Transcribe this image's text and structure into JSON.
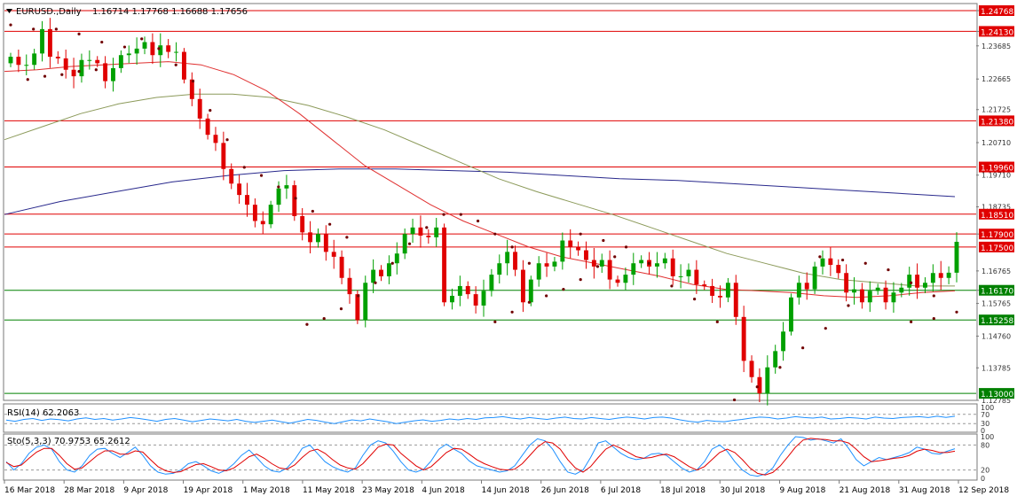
{
  "window": {
    "symbol_title": "EURUSD.,Daily",
    "ohlc": "1.16714 1.17768 1.16688 1.17656"
  },
  "colors": {
    "bull": "#00a000",
    "bear": "#e00000",
    "ma_fast": "#e03030",
    "ma_mid": "#8c9a5a",
    "ma_slow": "#28288c",
    "sar": "#700000",
    "resistance": "#e00000",
    "support": "#008000",
    "rsi": "#1e90ff",
    "stoch_main": "#1e90ff",
    "stoch_signal": "#e00000"
  },
  "chart_data": [
    {
      "type": "candlestick",
      "name": "price",
      "x_ticks": [
        "16 Mar 2018",
        "28 Mar 2018",
        "9 Apr 2018",
        "19 Apr 2018",
        "1 May 2018",
        "11 May 2018",
        "23 May 2018",
        "4 Jun 2018",
        "14 Jun 2018",
        "26 Jun 2018",
        "6 Jul 2018",
        "18 Jul 2018",
        "30 Jul 2018",
        "9 Aug 2018",
        "21 Aug 2018",
        "31 Aug 2018",
        "12 Sep 2018"
      ],
      "y_ticks": [
        "1.24768",
        "1.24130",
        "1.23685",
        "1.22665",
        "1.21725",
        "1.20710",
        "1.19710",
        "1.18735",
        "1.17900",
        "1.16765",
        "1.16170",
        "1.15765",
        "1.14760",
        "1.13785",
        "1.12785"
      ],
      "ylim": [
        1.12785,
        1.24768
      ],
      "levels": [
        {
          "value": 1.24768,
          "label": "1.24768",
          "kind": "resistance"
        },
        {
          "value": 1.2413,
          "label": "1.24130",
          "kind": "resistance"
        },
        {
          "value": 1.2138,
          "label": "1.21380",
          "kind": "resistance"
        },
        {
          "value": 1.1996,
          "label": "1.19960",
          "kind": "resistance"
        },
        {
          "value": 1.1851,
          "label": "1.18510",
          "kind": "resistance"
        },
        {
          "value": 1.179,
          "label": "1.17900",
          "kind": "resistance"
        },
        {
          "value": 1.175,
          "label": "1.17500",
          "kind": "resistance"
        },
        {
          "value": 1.1617,
          "label": "1.16170",
          "kind": "support"
        },
        {
          "value": 1.15258,
          "label": "1.15258",
          "kind": "support"
        },
        {
          "value": 1.13,
          "label": "1.13000",
          "kind": "support"
        }
      ],
      "closes": [
        1.2335,
        1.231,
        1.231,
        1.2345,
        1.242,
        1.2335,
        1.233,
        1.2295,
        1.2275,
        1.2325,
        1.2325,
        1.2315,
        1.226,
        1.23,
        1.234,
        1.2345,
        1.236,
        1.238,
        1.234,
        1.237,
        1.235,
        1.235,
        1.2265,
        1.2205,
        1.2145,
        1.2095,
        1.207,
        1.199,
        1.1945,
        1.191,
        1.188,
        1.183,
        1.182,
        1.188,
        1.193,
        1.194,
        1.1845,
        1.1795,
        1.1765,
        1.179,
        1.1735,
        1.172,
        1.1655,
        1.1605,
        1.1525,
        1.164,
        1.168,
        1.166,
        1.17,
        1.173,
        1.179,
        1.181,
        1.1785,
        1.178,
        1.181,
        1.158,
        1.16,
        1.163,
        1.1605,
        1.157,
        1.1615,
        1.1665,
        1.17,
        1.1735,
        1.168,
        1.158,
        1.165,
        1.17,
        1.169,
        1.1705,
        1.177,
        1.175,
        1.174,
        1.171,
        1.169,
        1.171,
        1.165,
        1.164,
        1.1665,
        1.17,
        1.171,
        1.169,
        1.17,
        1.1715,
        1.166,
        1.166,
        1.168,
        1.1635,
        1.163,
        1.16,
        1.1595,
        1.164,
        1.1535,
        1.14,
        1.135,
        1.13,
        1.138,
        1.143,
        1.149,
        1.1595,
        1.164,
        1.162,
        1.169,
        1.1715,
        1.1695,
        1.167,
        1.161,
        1.162,
        1.158,
        1.1615,
        1.1625,
        1.158,
        1.161,
        1.1625,
        1.1665,
        1.1625,
        1.164,
        1.167,
        1.1655,
        1.1671,
        1.1766
      ],
      "sma_fast": [
        1.229,
        1.2295,
        1.2305,
        1.231,
        1.2315,
        1.232,
        1.231,
        1.228,
        1.223,
        1.216,
        1.208,
        1.2,
        1.194,
        1.188,
        1.183,
        1.179,
        1.175,
        1.172,
        1.17,
        1.168,
        1.166,
        1.1635,
        1.162,
        1.1615,
        1.161,
        1.16,
        1.1595,
        1.16,
        1.161,
        1.1615
      ],
      "sma_mid": [
        1.208,
        1.212,
        1.216,
        1.219,
        1.221,
        1.222,
        1.222,
        1.221,
        1.2185,
        1.215,
        1.211,
        1.206,
        1.201,
        1.196,
        1.192,
        1.1885,
        1.185,
        1.181,
        1.177,
        1.173,
        1.17,
        1.167,
        1.165,
        1.164,
        1.163,
        1.163
      ],
      "sma_slow": [
        1.185,
        1.189,
        1.192,
        1.195,
        1.197,
        1.1985,
        1.199,
        1.199,
        1.1985,
        1.198,
        1.197,
        1.196,
        1.1955,
        1.1945,
        1.1935,
        1.1925,
        1.1915,
        1.1905
      ],
      "sar": [
        [
          0,
          1.2433
        ],
        [
          4,
          1.242
        ],
        [
          8,
          1.242
        ],
        [
          12,
          1.2405
        ],
        [
          16,
          1.238
        ],
        [
          20,
          1.2365
        ],
        [
          3,
          1.2265
        ],
        [
          6,
          1.2275
        ],
        [
          9,
          1.228
        ],
        [
          12,
          1.229
        ],
        [
          15,
          1.2295
        ],
        [
          23,
          1.239
        ],
        [
          26,
          1.236
        ],
        [
          29,
          1.231
        ],
        [
          32,
          1.226
        ],
        [
          35,
          1.217
        ],
        [
          38,
          1.208
        ],
        [
          41,
          1.1995
        ],
        [
          44,
          1.197
        ],
        [
          47,
          1.1935
        ],
        [
          50,
          1.19
        ],
        [
          53,
          1.186
        ],
        [
          56,
          1.182
        ],
        [
          59,
          1.178
        ],
        [
          52,
          1.1512
        ],
        [
          55,
          1.153
        ],
        [
          58,
          1.156
        ],
        [
          61,
          1.16
        ],
        [
          64,
          1.164
        ],
        [
          67,
          1.17
        ],
        [
          70,
          1.176
        ],
        [
          73,
          1.181
        ],
        [
          76,
          1.185
        ],
        [
          79,
          1.185
        ],
        [
          82,
          1.183
        ],
        [
          85,
          1.179
        ],
        [
          88,
          1.175
        ],
        [
          91,
          1.17
        ],
        [
          85,
          1.152
        ],
        [
          88,
          1.155
        ],
        [
          91,
          1.158
        ],
        [
          94,
          1.16
        ],
        [
          97,
          1.162
        ],
        [
          100,
          1.165
        ],
        [
          103,
          1.169
        ],
        [
          106,
          1.172
        ],
        [
          100,
          1.179
        ],
        [
          104,
          1.177
        ],
        [
          108,
          1.175
        ],
        [
          112,
          1.17
        ],
        [
          116,
          1.163
        ],
        [
          120,
          1.159
        ],
        [
          124,
          1.152
        ],
        [
          127,
          1.128
        ],
        [
          131,
          1.132
        ],
        [
          135,
          1.138
        ],
        [
          139,
          1.144
        ],
        [
          143,
          1.15
        ],
        [
          147,
          1.157
        ],
        [
          142,
          1.172
        ],
        [
          146,
          1.171
        ],
        [
          150,
          1.17
        ],
        [
          154,
          1.168
        ],
        [
          158,
          1.164
        ],
        [
          162,
          1.16
        ],
        [
          158,
          1.152
        ],
        [
          162,
          1.153
        ],
        [
          166,
          1.155
        ]
      ]
    },
    {
      "type": "line",
      "name": "rsi",
      "title": "RSI(14) 62.2063",
      "y_ticks": [
        "100",
        "70",
        "30",
        "0"
      ],
      "ylim": [
        0,
        100
      ],
      "levels": [
        70,
        30
      ],
      "values": [
        45,
        40,
        48,
        52,
        44,
        50,
        47,
        42,
        50,
        55,
        48,
        52,
        45,
        50,
        56,
        52,
        46,
        40,
        48,
        52,
        45,
        38,
        44,
        50,
        46,
        42,
        48,
        40,
        35,
        40,
        45,
        38,
        32,
        40,
        48,
        44,
        36,
        30,
        38,
        46,
        42,
        50,
        44,
        38,
        30,
        36,
        42,
        46,
        40,
        44,
        50,
        46,
        52,
        48,
        55,
        56,
        60,
        54,
        50,
        56,
        52,
        48,
        54,
        58,
        52,
        50,
        56,
        52,
        48,
        54,
        58,
        55,
        50,
        56,
        58,
        54,
        46,
        40,
        36,
        44,
        40,
        38,
        44,
        48,
        54,
        58,
        56,
        50,
        54,
        60,
        56,
        54,
        58,
        50,
        52,
        56,
        54,
        50,
        58,
        54,
        52,
        56,
        58,
        60,
        56,
        62,
        57,
        62
      ]
    },
    {
      "type": "line",
      "name": "stochastic",
      "title": "Sto(5,3,3) 70.9753 65.2612",
      "y_ticks": [
        "100",
        "80",
        "20",
        "0"
      ],
      "ylim": [
        0,
        100
      ],
      "levels": [
        80,
        20
      ],
      "series": [
        {
          "values": [
            40,
            20,
            35,
            60,
            75,
            80,
            70,
            40,
            20,
            15,
            30,
            55,
            70,
            72,
            60,
            50,
            62,
            75,
            55,
            30,
            15,
            10,
            12,
            20,
            35,
            40,
            30,
            18,
            12,
            20,
            35,
            55,
            68,
            50,
            30,
            18,
            15,
            25,
            45,
            72,
            80,
            60,
            40,
            28,
            20,
            15,
            25,
            55,
            80,
            90,
            85,
            65,
            40,
            20,
            15,
            22,
            42,
            70,
            82,
            70,
            60,
            42,
            30,
            25,
            20,
            15,
            18,
            30,
            55,
            80,
            95,
            90,
            70,
            40,
            15,
            10,
            20,
            50,
            85,
            90,
            75,
            60,
            50,
            45,
            48,
            58,
            60,
            55,
            40,
            25,
            15,
            20,
            40,
            70,
            80,
            65,
            40,
            20,
            8,
            5,
            10,
            25,
            55,
            80,
            100,
            98,
            92,
            95,
            90,
            85,
            95,
            72,
            45,
            30,
            40,
            50,
            45,
            50,
            55,
            62,
            75,
            70,
            60,
            58,
            65,
            71
          ]
        },
        {
          "values": [
            38,
            28,
            32,
            48,
            63,
            72,
            72,
            55,
            35,
            22,
            25,
            40,
            55,
            66,
            66,
            58,
            58,
            66,
            63,
            45,
            28,
            18,
            14,
            16,
            25,
            33,
            35,
            28,
            20,
            18,
            25,
            38,
            52,
            58,
            48,
            35,
            25,
            22,
            32,
            50,
            65,
            70,
            60,
            45,
            32,
            25,
            22,
            35,
            55,
            75,
            82,
            80,
            60,
            45,
            30,
            20,
            28,
            45,
            62,
            72,
            70,
            58,
            45,
            35,
            28,
            22,
            20,
            22,
            35,
            55,
            75,
            88,
            85,
            70,
            45,
            25,
            15,
            28,
            50,
            70,
            80,
            72,
            62,
            52,
            48,
            50,
            55,
            58,
            52,
            40,
            28,
            20,
            28,
            45,
            62,
            70,
            62,
            45,
            25,
            12,
            8,
            14,
            30,
            52,
            75,
            92,
            96,
            94,
            93,
            90,
            90,
            85,
            70,
            52,
            40,
            42,
            45,
            48,
            50,
            55,
            65,
            70,
            67,
            62,
            62,
            65
          ]
        }
      ]
    }
  ]
}
